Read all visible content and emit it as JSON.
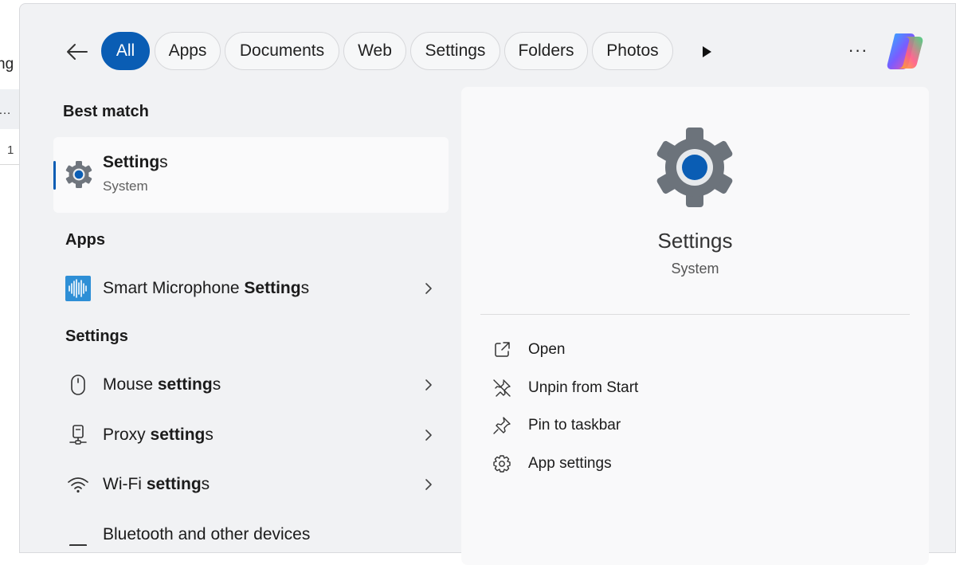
{
  "background_window": {
    "partial_text_1": "ng",
    "partial_text_2": "…",
    "partial_text_3": "1"
  },
  "filters": {
    "back_label": "Back",
    "chips": [
      "All",
      "Apps",
      "Documents",
      "Web",
      "Settings",
      "Folders",
      "Photos"
    ],
    "active": "All",
    "more_label": "···"
  },
  "results": {
    "best_match_heading": "Best match",
    "best_match": {
      "title_main": "Setting",
      "title_tail": "s",
      "subtitle": "System"
    },
    "apps_heading": "Apps",
    "apps": [
      {
        "prefix": "Smart Microphone ",
        "bold": "Setting",
        "suffix": "s",
        "icon": "microphone-app-icon"
      }
    ],
    "settings_heading": "Settings",
    "settings": [
      {
        "prefix": "Mouse ",
        "bold": "setting",
        "suffix": "s",
        "icon": "mouse-icon"
      },
      {
        "prefix": "Proxy ",
        "bold": "setting",
        "suffix": "s",
        "icon": "proxy-icon"
      },
      {
        "prefix": "Wi-Fi ",
        "bold": "setting",
        "suffix": "s",
        "icon": "wifi-icon"
      },
      {
        "prefix": "Bluetooth and other devices",
        "bold": "",
        "suffix": "",
        "icon": "bluetooth-icon"
      }
    ]
  },
  "detail": {
    "title": "Settings",
    "subtitle": "System",
    "actions": [
      {
        "label": "Open",
        "icon": "open-external-icon"
      },
      {
        "label": "Unpin from Start",
        "icon": "unpin-icon"
      },
      {
        "label": "Pin to taskbar",
        "icon": "pin-icon"
      },
      {
        "label": "App settings",
        "icon": "gear-icon"
      }
    ]
  },
  "colors": {
    "accent": "#0a5db4",
    "panel": "#f1f2f4",
    "detail": "#f9f9fa"
  }
}
